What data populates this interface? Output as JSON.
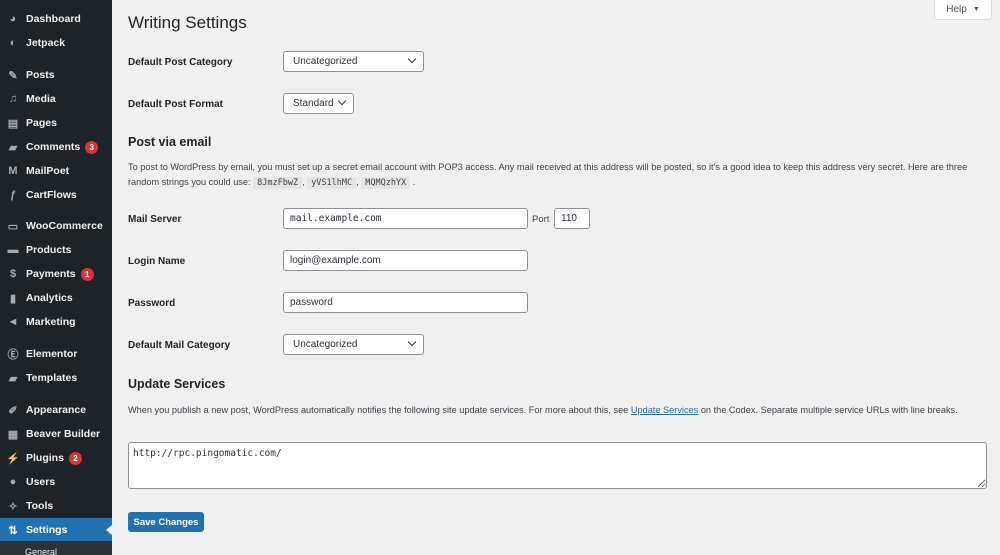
{
  "sidebar": {
    "items": [
      {
        "label": "Dashboard",
        "icon": "dashboard-icon",
        "glyph": "◕"
      },
      {
        "label": "Jetpack",
        "icon": "jetpack-icon",
        "glyph": "◐"
      },
      {
        "label": "Posts",
        "icon": "pin-icon",
        "glyph": "✎"
      },
      {
        "label": "Media",
        "icon": "media-icon",
        "glyph": "♫"
      },
      {
        "label": "Pages",
        "icon": "pages-icon",
        "glyph": "▤"
      },
      {
        "label": "Comments",
        "icon": "comment-icon",
        "glyph": "▰",
        "badge": "3"
      },
      {
        "label": "MailPoet",
        "icon": "mailpoet-icon",
        "glyph": "M"
      },
      {
        "label": "CartFlows",
        "icon": "cartflows-icon",
        "glyph": "ƒ"
      },
      {
        "label": "WooCommerce",
        "icon": "woocommerce-icon",
        "glyph": "▭"
      },
      {
        "label": "Products",
        "icon": "products-icon",
        "glyph": "▬"
      },
      {
        "label": "Payments",
        "icon": "payments-icon",
        "glyph": "$",
        "badge": "1"
      },
      {
        "label": "Analytics",
        "icon": "bar-chart-icon",
        "glyph": "▮"
      },
      {
        "label": "Marketing",
        "icon": "megaphone-icon",
        "glyph": "◄"
      },
      {
        "label": "Elementor",
        "icon": "elementor-icon",
        "glyph": "Ⓔ"
      },
      {
        "label": "Templates",
        "icon": "folder-icon",
        "glyph": "▰"
      },
      {
        "label": "Appearance",
        "icon": "paintbrush-icon",
        "glyph": "✐"
      },
      {
        "label": "Beaver Builder",
        "icon": "beaver-builder-icon",
        "glyph": "▦"
      },
      {
        "label": "Plugins",
        "icon": "plug-icon",
        "glyph": "⚡",
        "badge": "2"
      },
      {
        "label": "Users",
        "icon": "user-icon",
        "glyph": "●"
      },
      {
        "label": "Tools",
        "icon": "wrench-icon",
        "glyph": "✧"
      },
      {
        "label": "Settings",
        "icon": "settings-icon",
        "glyph": "⇅",
        "active": true
      }
    ],
    "submenu_peek": "General"
  },
  "help": {
    "label": "Help",
    "arrow": "▼"
  },
  "page": {
    "title": "Writing Settings",
    "default_post_category": {
      "label": "Default Post Category",
      "value": "Uncategorized"
    },
    "default_post_format": {
      "label": "Default Post Format",
      "value": "Standard"
    },
    "post_via_email": {
      "heading": "Post via email",
      "desc_before": "To post to WordPress by email, you must set up a secret email account with POP3 access. Any mail received at this address will be posted, so it’s a good idea to keep this address very secret. Here are three random strings you could use: ",
      "codes": [
        "8JmzFbwZ",
        "yVS1lhMC",
        "MQMQzhYX"
      ],
      "mail_server": {
        "label": "Mail Server",
        "value": "mail.example.com"
      },
      "port": {
        "label": "Port",
        "value": "110"
      },
      "login_name": {
        "label": "Login Name",
        "value": "login@example.com"
      },
      "password": {
        "label": "Password",
        "value": "password"
      },
      "default_mail_category": {
        "label": "Default Mail Category",
        "value": "Uncategorized"
      }
    },
    "update_services": {
      "heading": "Update Services",
      "desc_before": "When you publish a new post, WordPress automatically notifies the following site update services. For more about this, see ",
      "link": "Update Services",
      "desc_after": " on the Codex. Separate multiple service URLs with line breaks.",
      "value": "http://rpc.pingomatic.com/"
    },
    "save_label": "Save Changes"
  },
  "colors": {
    "accent": "#2271b1",
    "sidebar_bg": "#1d2327",
    "badge": "#d63638",
    "page_bg": "#f0f0f1"
  }
}
